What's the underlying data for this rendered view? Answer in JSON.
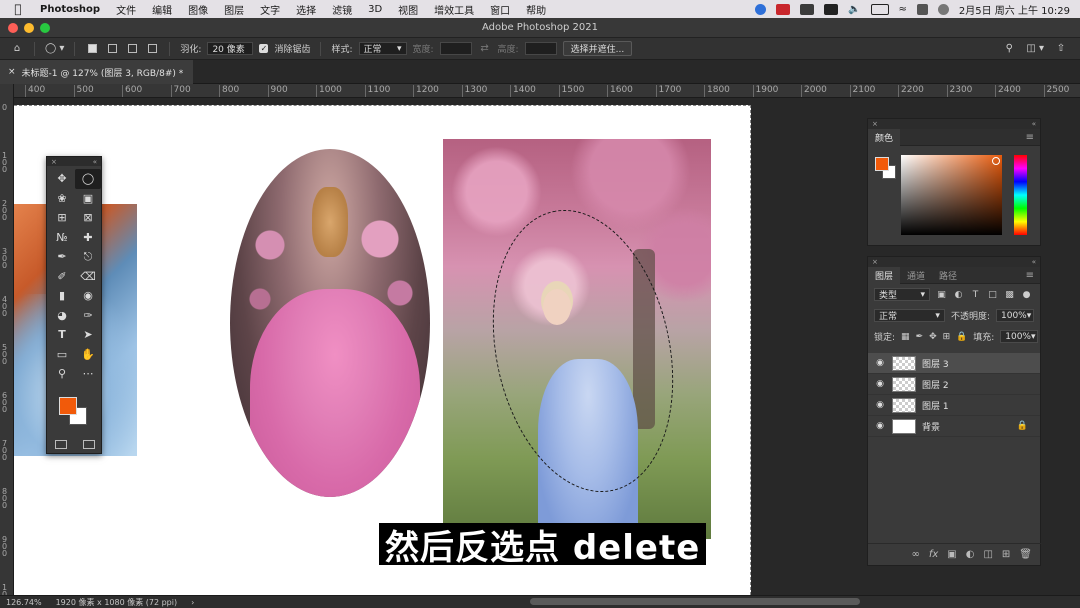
{
  "menubar": {
    "app": "Photoshop",
    "items": [
      "文件",
      "编辑",
      "图像",
      "图层",
      "文字",
      "选择",
      "滤镜",
      "3D",
      "视图",
      "增效工具",
      "窗口",
      "帮助"
    ],
    "clock": "2月5日 周六 上午 10:29"
  },
  "window": {
    "title": "Adobe Photoshop 2021"
  },
  "options": {
    "feather_label": "羽化:",
    "feather_value": "20 像素",
    "antialias_label": "消除锯齿",
    "style_label": "样式:",
    "style_value": "正常",
    "width_label": "宽度:",
    "height_label": "高度:",
    "refine_label": "选择并遮住..."
  },
  "document": {
    "tab_title": "未标题-1 @ 127% (图层 3, RGB/8#) *"
  },
  "ruler_h": [
    "400",
    "500",
    "600",
    "700",
    "800",
    "900",
    "1000",
    "1100",
    "1200",
    "1300",
    "1400",
    "1500",
    "1600",
    "1700",
    "1800",
    "1900",
    "2000",
    "2100",
    "2200",
    "2300",
    "2400",
    "2500"
  ],
  "ruler_v": [
    "0",
    "1 0 0",
    "2 0 0",
    "3 0 0",
    "4 0 0",
    "5 0 0",
    "6 0 0",
    "7 0 0",
    "8 0 0",
    "9 0 0",
    "1 0 0 0"
  ],
  "subtitle": "然后反选点 delete",
  "colors": {
    "foreground": "#f15a0a",
    "background": "#ffffff"
  },
  "color_panel": {
    "tab": "颜色"
  },
  "layers_panel": {
    "tabs": [
      "图层",
      "通道",
      "路径"
    ],
    "filter_label": "类型",
    "blend_mode": "正常",
    "opacity_label": "不透明度:",
    "opacity_value": "100%",
    "lock_label": "锁定:",
    "fill_label": "填充:",
    "fill_value": "100%",
    "layers": [
      {
        "name": "图层 3",
        "selected": true
      },
      {
        "name": "图层 2",
        "selected": false
      },
      {
        "name": "图层 1",
        "selected": false
      },
      {
        "name": "背景",
        "selected": false,
        "locked": true
      }
    ]
  },
  "status": {
    "zoom": "126.74%",
    "doc_size": "1920 像素 x 1080 像素 (72 ppi)"
  }
}
